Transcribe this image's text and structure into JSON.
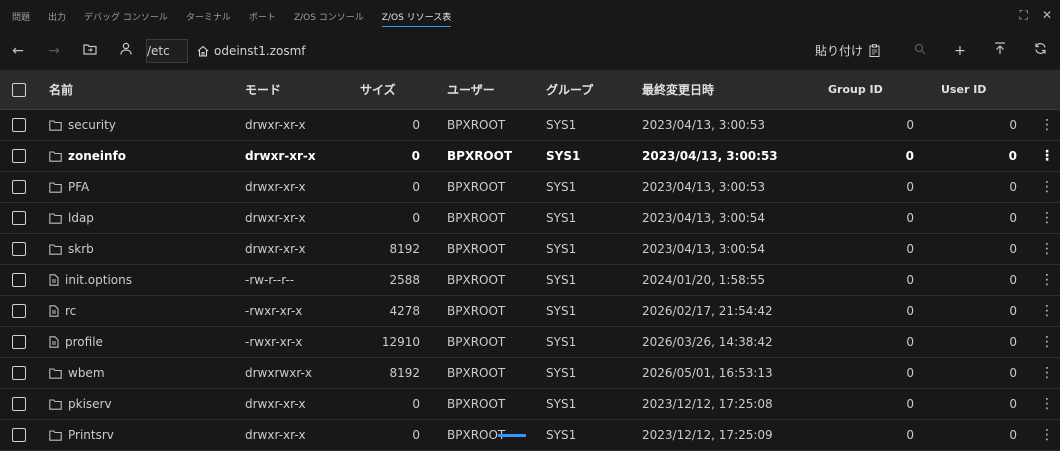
{
  "panel": {
    "tabs": [
      "問題",
      "出力",
      "デバッグ コンソール",
      "ターミナル",
      "ポート",
      "Z/OS コンソール",
      "Z/OS リソース表"
    ],
    "active_tab": "Z/OS リソース表"
  },
  "toolbar": {
    "path": "/etc",
    "host": "odeinst1.zosmf",
    "paste_label": "貼り付け"
  },
  "table": {
    "headers": {
      "name": "名前",
      "mode": "モード",
      "size": "サイズ",
      "owner": "ユーザー",
      "group": "グループ",
      "modified": "最終変更日時",
      "group_id": "Group ID",
      "user_id": "User ID"
    },
    "rows": [
      {
        "type": "folder",
        "name": "security",
        "mode": "drwxr-xr-x",
        "size": "0",
        "owner": "BPXROOT",
        "group": "SYS1",
        "modified": "2023/04/13, 3:00:53",
        "gid": "0",
        "uid": "0"
      },
      {
        "type": "folder",
        "name": "zoneinfo",
        "mode": "drwxr-xr-x",
        "size": "0",
        "owner": "BPXROOT",
        "group": "SYS1",
        "modified": "2023/04/13, 3:00:53",
        "gid": "0",
        "uid": "0"
      },
      {
        "type": "folder",
        "name": "PFA",
        "mode": "drwxr-xr-x",
        "size": "0",
        "owner": "BPXROOT",
        "group": "SYS1",
        "modified": "2023/04/13, 3:00:53",
        "gid": "0",
        "uid": "0"
      },
      {
        "type": "folder",
        "name": "ldap",
        "mode": "drwxr-xr-x",
        "size": "0",
        "owner": "BPXROOT",
        "group": "SYS1",
        "modified": "2023/04/13, 3:00:54",
        "gid": "0",
        "uid": "0"
      },
      {
        "type": "folder",
        "name": "skrb",
        "mode": "drwxr-xr-x",
        "size": "8192",
        "owner": "BPXROOT",
        "group": "SYS1",
        "modified": "2023/04/13, 3:00:54",
        "gid": "0",
        "uid": "0"
      },
      {
        "type": "file",
        "name": "init.options",
        "mode": "-rw-r--r--",
        "size": "2588",
        "owner": "BPXROOT",
        "group": "SYS1",
        "modified": "2024/01/20, 1:58:55",
        "gid": "0",
        "uid": "0"
      },
      {
        "type": "file",
        "name": "rc",
        "mode": "-rwxr-xr-x",
        "size": "4278",
        "owner": "BPXROOT",
        "group": "SYS1",
        "modified": "2026/02/17, 21:54:42",
        "gid": "0",
        "uid": "0"
      },
      {
        "type": "file",
        "name": "profile",
        "mode": "-rwxr-xr-x",
        "size": "12910",
        "owner": "BPXROOT",
        "group": "SYS1",
        "modified": "2026/03/26, 14:38:42",
        "gid": "0",
        "uid": "0"
      },
      {
        "type": "folder",
        "name": "wbem",
        "mode": "drwxrwxr-x",
        "size": "8192",
        "owner": "BPXROOT",
        "group": "SYS1",
        "modified": "2026/05/01, 16:53:13",
        "gid": "0",
        "uid": "0"
      },
      {
        "type": "folder",
        "name": "pkiserv",
        "mode": "drwxr-xr-x",
        "size": "0",
        "owner": "BPXROOT",
        "group": "SYS1",
        "modified": "2023/12/12, 17:25:08",
        "gid": "0",
        "uid": "0"
      },
      {
        "type": "folder",
        "name": "Printsrv",
        "mode": "drwxr-xr-x",
        "size": "0",
        "owner": "BPXROOT",
        "group": "SYS1",
        "modified": "2023/12/12, 17:25:09",
        "gid": "0",
        "uid": "0"
      }
    ]
  }
}
